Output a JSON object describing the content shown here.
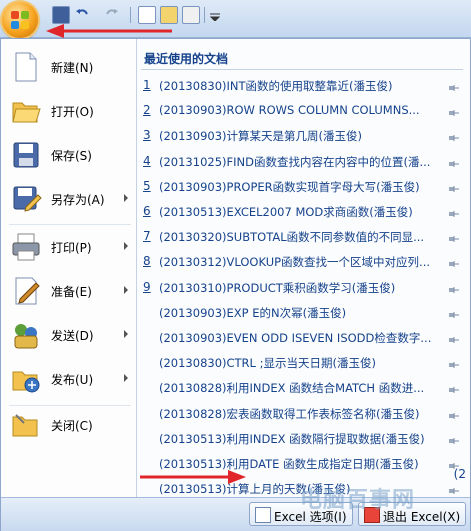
{
  "recent": {
    "title": "最近使用的文档",
    "docs": [
      {
        "num": "1",
        "name": "(20130830)INT函数的使用取整靠近(潘玉俊)"
      },
      {
        "num": "2",
        "name": "(20130903)ROW ROWS COLUMN COLUMNS..."
      },
      {
        "num": "3",
        "name": "(20130903)计算某天是第几周(潘玉俊)"
      },
      {
        "num": "4",
        "name": "(20131025)FIND函数查找内容在内容中的位置(潘..."
      },
      {
        "num": "5",
        "name": "(20130903)PROPER函数实现首字母大写(潘玉俊)"
      },
      {
        "num": "6",
        "name": "(20130513)EXCEL2007 MOD求商函数(潘玉俊)"
      },
      {
        "num": "7",
        "name": "(20130320)SUBTOTAL函数不同参数值的不同显..."
      },
      {
        "num": "8",
        "name": "(20130312)VLOOKUP函数查找一个区域中对应列..."
      },
      {
        "num": "9",
        "name": "(20130310)PRODUCT乘积函数学习(潘玉俊)"
      },
      {
        "num": "",
        "name": "(20130903)EXP E的N次幂(潘玉俊)"
      },
      {
        "num": "",
        "name": "(20130903)EVEN ODD ISEVEN ISODD检查数字..."
      },
      {
        "num": "",
        "name": "(20130830)CTRL ;显示当天日期(潘玉俊)"
      },
      {
        "num": "",
        "name": "(20130828)利用INDEX 函数结合MATCH 函数进..."
      },
      {
        "num": "",
        "name": "(20130828)宏表函数取得工作表标签名称(潘玉俊)"
      },
      {
        "num": "",
        "name": "(20130513)利用INDEX 函数隔行提取数据(潘玉俊)"
      },
      {
        "num": "",
        "name": "(20130513)利用DATE 函数生成指定日期(潘玉俊)"
      },
      {
        "num": "",
        "name": "(20130513)计算上月的天数(潘玉俊)"
      }
    ]
  },
  "commands": {
    "new": "新建(N)",
    "open": "打开(O)",
    "save": "保存(S)",
    "saveas": "另存为(A)",
    "print": "打印(P)",
    "prepare": "准备(E)",
    "send": "发送(D)",
    "publish": "发布(U)",
    "close": "关闭(C)"
  },
  "footer": {
    "options": "Excel 选项(I)",
    "exit": "退出 Excel(X)"
  },
  "watermark": "电脑百事网",
  "edge_text": "(2",
  "colors": {
    "accent": "#15428b",
    "arrow": "#e0262b",
    "office_button": "#f6a21c"
  }
}
